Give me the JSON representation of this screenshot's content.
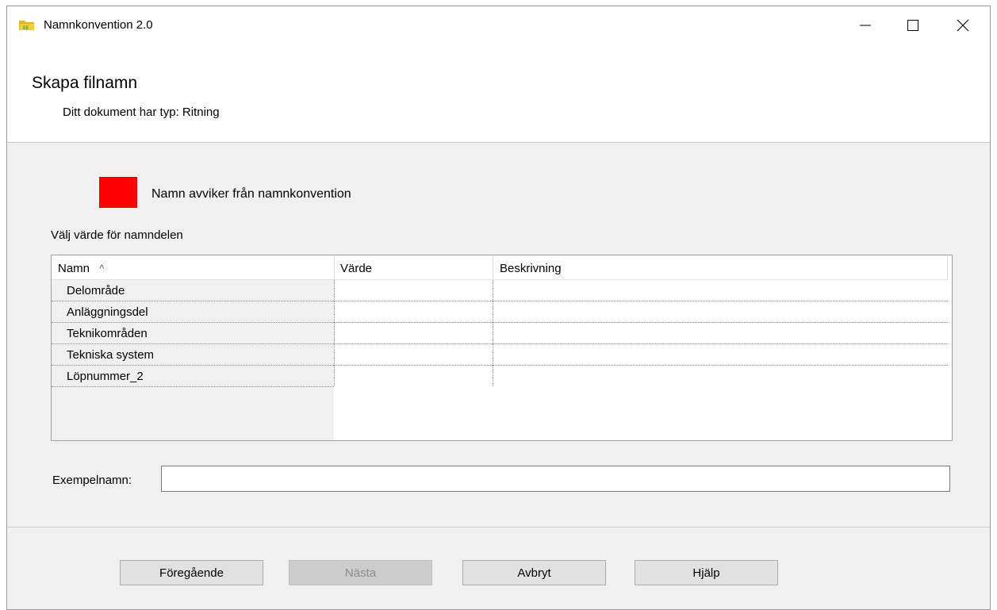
{
  "window": {
    "title": "Namnkonvention 2.0"
  },
  "header": {
    "heading": "Skapa filnamn",
    "subheading": "Ditt dokument har typ: Ritning"
  },
  "status": {
    "color": "#ff0000",
    "label": "Namn avviker från namnkonvention"
  },
  "section_label": "Välj värde för namndelen",
  "table": {
    "columns": [
      "Namn",
      "Värde",
      "Beskrivning"
    ],
    "sort_indicator": "^",
    "rows": [
      {
        "name": "Delområde",
        "value": "",
        "description": ""
      },
      {
        "name": "Anläggningsdel",
        "value": "",
        "description": ""
      },
      {
        "name": "Teknikområden",
        "value": "",
        "description": ""
      },
      {
        "name": "Tekniska system",
        "value": "",
        "description": ""
      },
      {
        "name": "Löpnummer_2",
        "value": "",
        "description": ""
      }
    ]
  },
  "example": {
    "label": "Exempelnamn:",
    "value": ""
  },
  "buttons": {
    "previous": "Föregående",
    "next": "Nästa",
    "cancel": "Avbryt",
    "help": "Hjälp"
  }
}
